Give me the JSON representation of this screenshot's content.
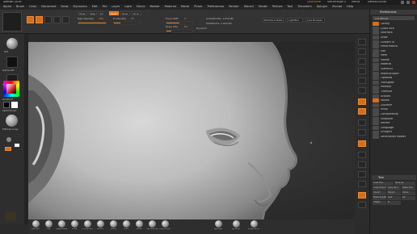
{
  "app": {
    "title": "ZBrush 2019"
  },
  "menu": [
    "Alpha",
    "Brush",
    "Color",
    "Document",
    "Draw",
    "Dynamics",
    "Edit",
    "File",
    "Layer",
    "Light",
    "Macro",
    "Marker",
    "Material",
    "Movie",
    "Picker",
    "Preferences",
    "Render",
    "Stencil",
    "Stroke",
    "Texture",
    "Tool",
    "Transform",
    "Zplugin",
    "Zscript",
    "Help"
  ],
  "titlebar_right": [
    "QuickSave",
    "See-through 0",
    "Menus",
    "DefaultZScript"
  ],
  "toolbar": {
    "mrgb": "Mrgb",
    "rgb": "Rgb",
    "m": "M",
    "zadd": "Zadd",
    "zsub": "Zsub",
    "zcut": "Zcut",
    "rgb_intensity_label": "Rgb Intensity",
    "rgb_intensity": "100",
    "z_intensity_label": "Z Intensity",
    "z_intensity": "25",
    "focal_shift_label": "Focal Shift",
    "focal_shift": "0",
    "draw_size_label": "Draw Size",
    "draw_size": "64",
    "dynamic_label": "Dynamic",
    "active_points": "ActivePoints: 1.019 Mil",
    "total_points": "TotalPoints: 1.019 Mil",
    "backface_mask": "Backface Mask",
    "lightbox": "LightBox",
    "livebool": "Live Boolean"
  },
  "left_panel": {
    "labels": [
      "Std",
      "Alpha Off",
      "Texture Off",
      "MatCap Gray",
      "Gradient",
      "SwitchColor",
      "Alternate"
    ]
  },
  "viewport": {
    "label": "viewport"
  },
  "bottom_brushes": [
    "Standard",
    "Clay",
    "ClayBuildup",
    "Move",
    "TrimDynamic",
    "hPolish",
    "Inflate",
    "Pinch",
    "Flatten",
    "DamStandard",
    "Orb_Cracks"
  ],
  "bottom_right": [
    "Spotlight",
    "Dynamic",
    "Sculptris Pro"
  ],
  "tray": {
    "title": "Preferences",
    "subtitle": "Init ZBrush",
    "items": [
      "Config",
      "Quick Info",
      "Interface",
      "Draw",
      "Custom UI",
      "Performance",
      "Edit",
      "Mem",
      "Marker",
      "Material",
      "Gizmo3D",
      "Import/Export",
      "LightBox",
      "Transpose",
      "Hotkeys",
      "Timeline",
      "Utilities",
      "Mouse",
      "ZSphere",
      "Undo",
      "Compatibility",
      "Snapshot",
      "Render",
      "Language",
      "ZPlugins",
      "Decimation Master"
    ],
    "bottom_title": "Tool",
    "bottom_buttons": [
      "Load Tool",
      "Save As",
      "Load Tools From Project",
      "Copy Tool",
      "Paste Tool",
      "Import",
      "Export",
      "Clone",
      "Make PolyMesh3D",
      "GoZ",
      "All",
      "Visible",
      "R"
    ]
  },
  "colors": {
    "accent": "#e07a1f",
    "panel": "#2e2e2e"
  }
}
